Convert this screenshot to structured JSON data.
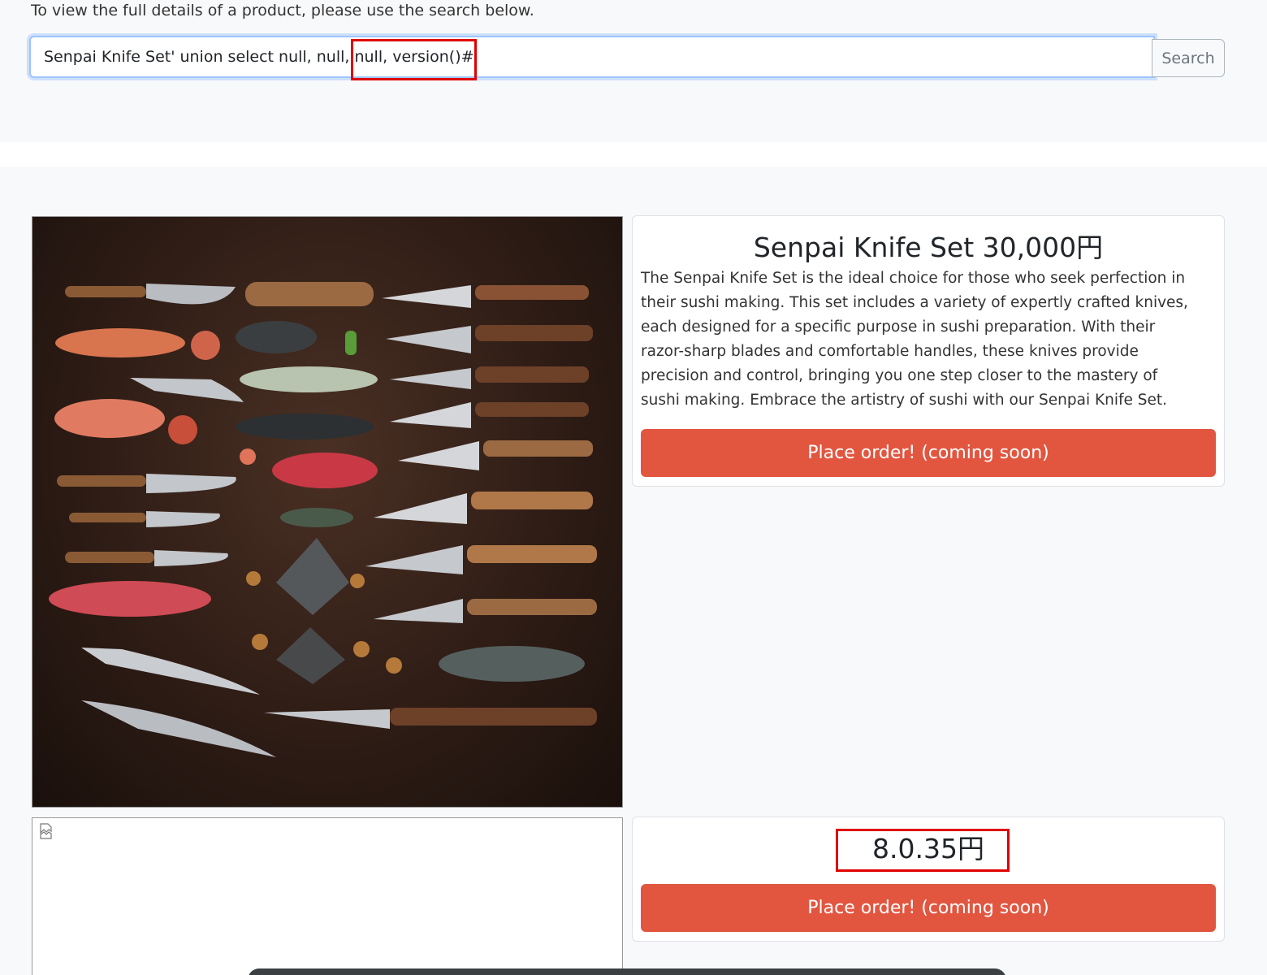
{
  "intro_text": "To view the full details of a product, please use the search below.",
  "search": {
    "value": "Senpai Knife Set' union select null, null, null, version()#",
    "button_label": "Search"
  },
  "products": [
    {
      "title": "Senpai Knife Set 30,000円",
      "description": "The Senpai Knife Set is the ideal choice for those who seek perfection in their sushi making. This set includes a variety of expertly crafted knives, each designed for a specific purpose in sushi preparation. With their razor-sharp blades and comfortable handles, these knives provide precision and control, bringing you one step closer to the mastery of sushi making. Embrace the artistry of sushi with our Senpai Knife Set.",
      "button_label": "Place order! (coming soon)"
    },
    {
      "title": "8.0.35円",
      "description": "",
      "button_label": "Place order! (coming soon)"
    }
  ],
  "colors": {
    "order_button": "#e25640",
    "highlight": "#e00000",
    "focus_border": "#9ec5fe"
  },
  "icons": {
    "broken_image": "broken-image-icon"
  }
}
